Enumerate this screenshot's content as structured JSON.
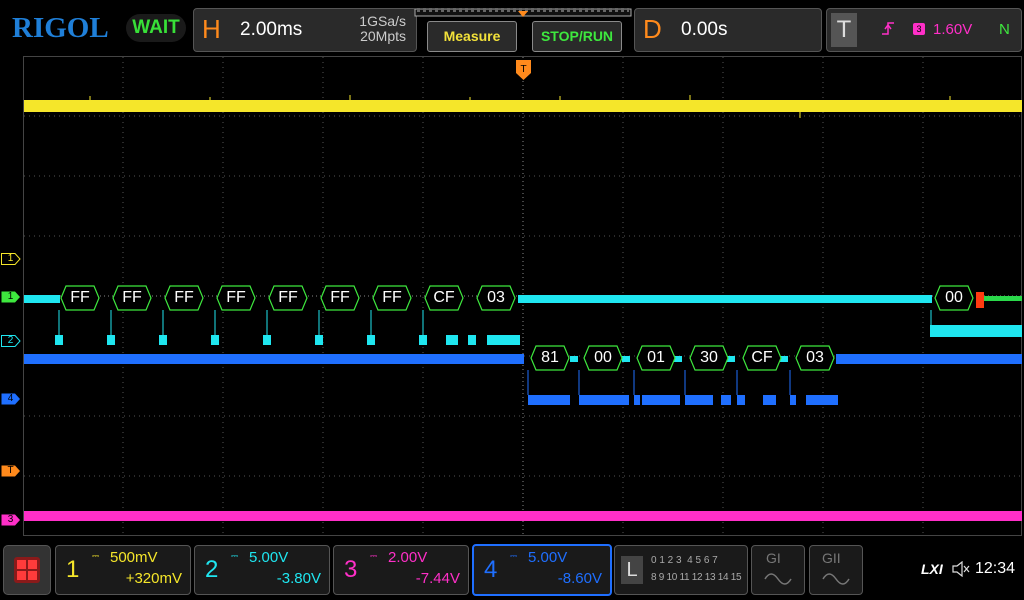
{
  "brand": "RIGOL",
  "status": "WAIT",
  "horizontal": {
    "letter": "H",
    "timebase": "2.00ms",
    "sample_rate": "1GSa/s",
    "memory_depth": "20Mpts"
  },
  "buttons": {
    "measure": "Measure",
    "stop_run": "STOP/RUN"
  },
  "delay": {
    "letter": "D",
    "value": "0.00s"
  },
  "trigger": {
    "letter": "T",
    "level": "1.60V",
    "sweep": "N",
    "color": "#ff2fc8"
  },
  "markers": {
    "ch1_a": "1",
    "ch1_b": "1",
    "ch2": "2",
    "ch4": "4",
    "trig": "T",
    "ch3": "3"
  },
  "decode_top": [
    "FF",
    "FF",
    "FF",
    "FF",
    "FF",
    "FF",
    "FF",
    "CF",
    "03"
  ],
  "decode_top_end": "00",
  "decode_bottom": [
    "81",
    "00",
    "01",
    "30",
    "CF",
    "03"
  ],
  "channels": [
    {
      "num": "1",
      "scale": "500mV",
      "offset": "+320mV",
      "color": "#f5e62a"
    },
    {
      "num": "2",
      "scale": "5.00V",
      "offset": "-3.80V",
      "color": "#1fe6f0"
    },
    {
      "num": "3",
      "scale": "2.00V",
      "offset": "-7.44V",
      "color": "#ff2fc8"
    },
    {
      "num": "4",
      "scale": "5.00V",
      "offset": "-8.60V",
      "color": "#1f7fff"
    }
  ],
  "logic": {
    "letter": "L",
    "row1": "0 1 2 3  4 5 6 7",
    "row2": "8 9 10 11 12 13 14 15"
  },
  "gen1": "GI",
  "gen2": "GII",
  "lxi": "LXI",
  "clock": "12:34",
  "colors": {
    "yellow": "#f5e62a",
    "cyan": "#1fe6f0",
    "blue": "#1f6fff",
    "magenta": "#ff2fc8",
    "green": "#3ee83e",
    "orange": "#ff8a1c"
  }
}
